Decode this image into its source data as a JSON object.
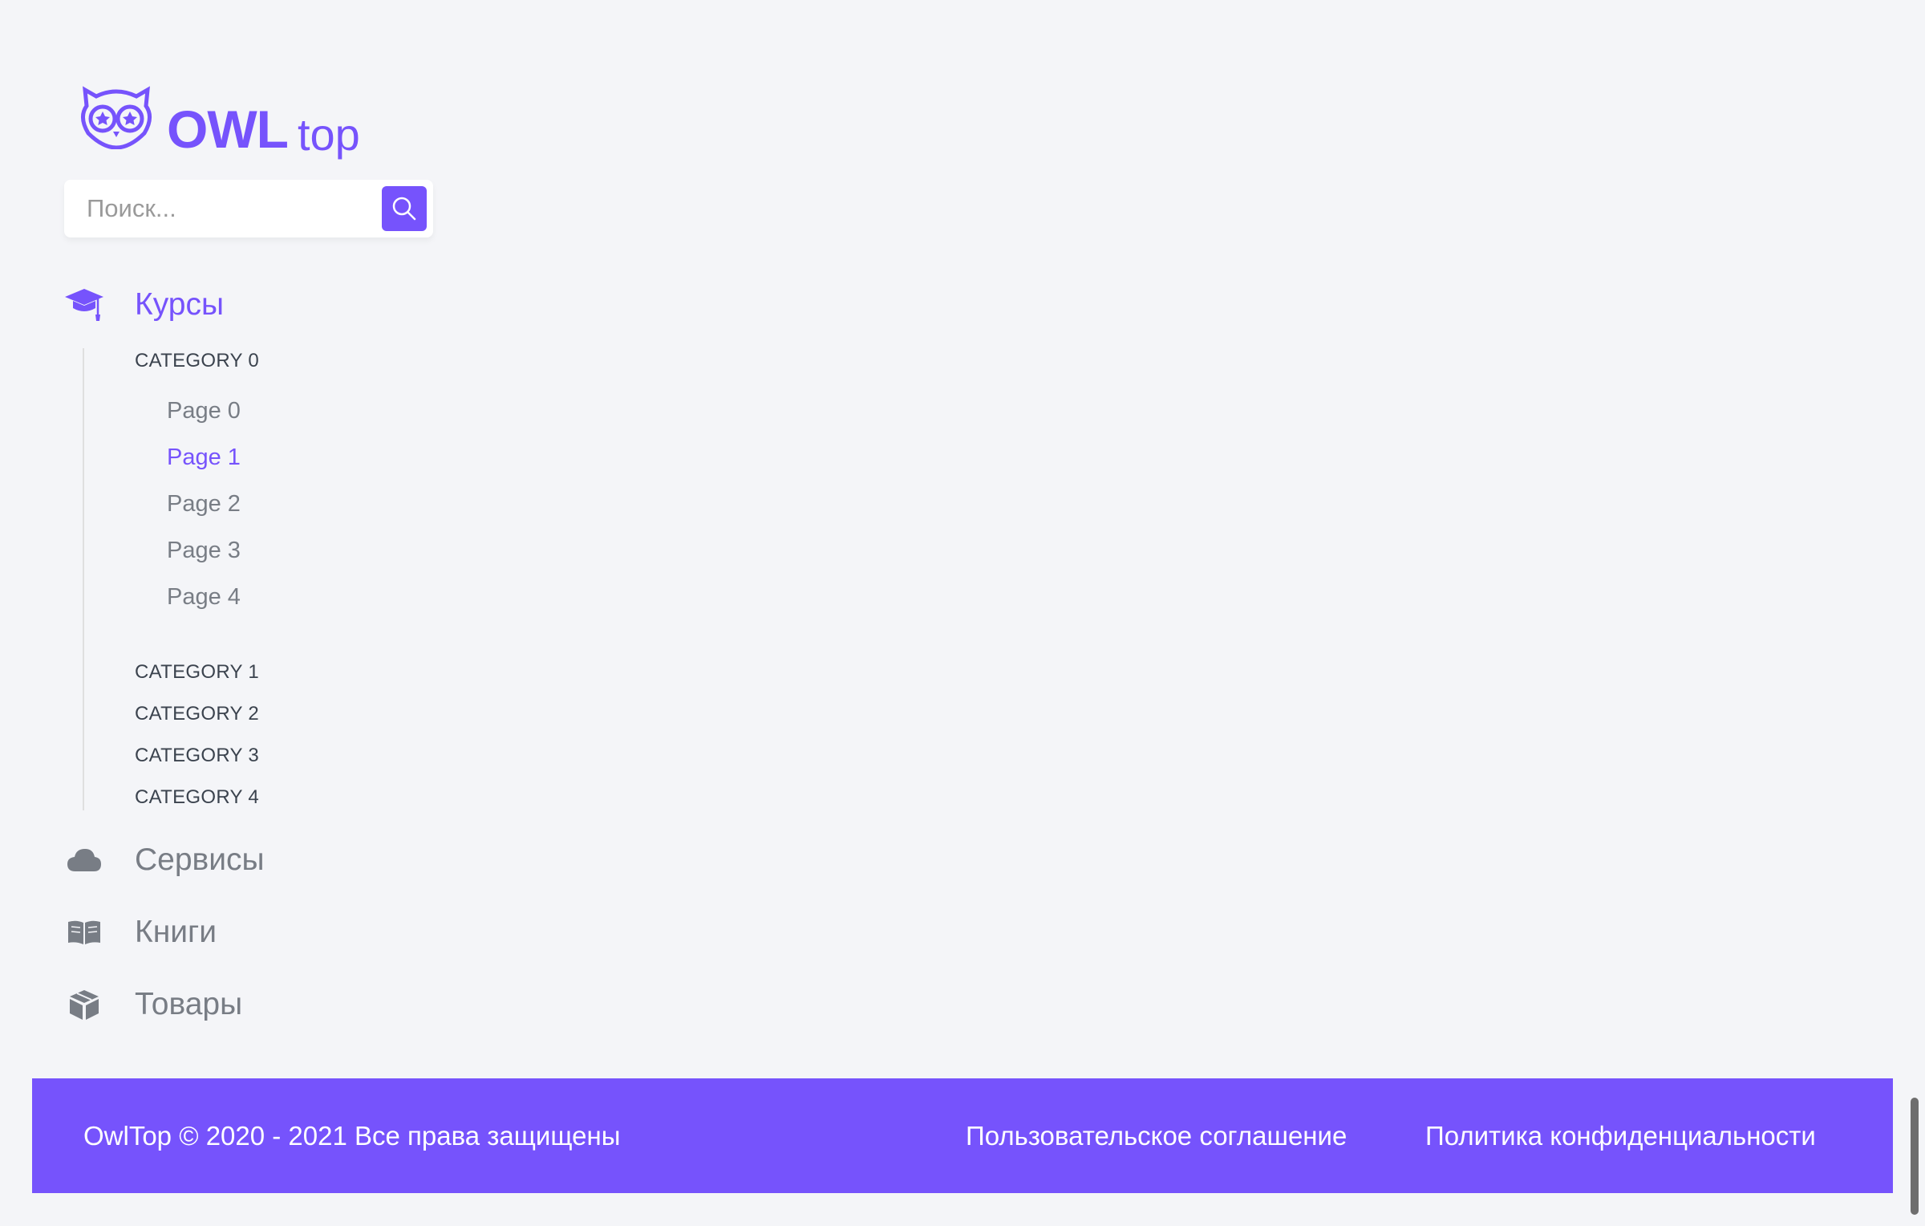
{
  "logo": {
    "brand": "OWL",
    "suffix": "top"
  },
  "search": {
    "placeholder": "Поиск..."
  },
  "menu": {
    "courses": "Курсы",
    "services": "Сервисы",
    "books": "Книги",
    "goods": "Товары"
  },
  "categories": [
    "CATEGORY 0",
    "CATEGORY 1",
    "CATEGORY 2",
    "CATEGORY 3",
    "CATEGORY 4"
  ],
  "pages": [
    "Page 0",
    "Page 1",
    "Page 2",
    "Page 3",
    "Page 4"
  ],
  "active_page": "Page 1",
  "footer": {
    "copyright": "OwlTop © 2020 - 2021 Все права защищены",
    "agreement": "Пользовательское соглашение",
    "privacy": "Политика конфиденциальности"
  },
  "colors": {
    "accent": "#7653FC",
    "background": "#F4F5F8",
    "text": "#787D85"
  }
}
